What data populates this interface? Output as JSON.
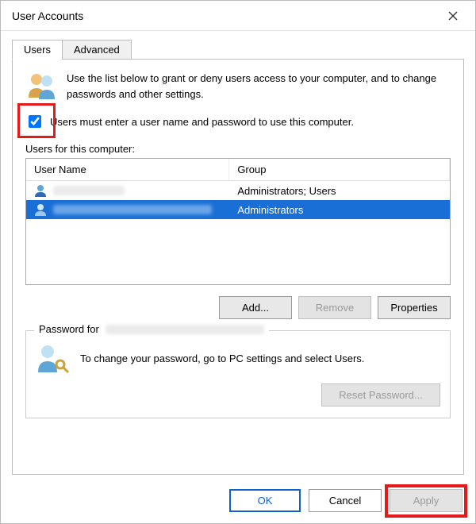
{
  "window": {
    "title": "User Accounts"
  },
  "tabs": {
    "users": "Users",
    "advanced": "Advanced"
  },
  "intro": "Use the list below to grant or deny users access to your computer, and to change passwords and other settings.",
  "checkbox": {
    "label": "Users must enter a user name and password to use this computer.",
    "checked": true
  },
  "users_for_label": "Users for this computer:",
  "columns": {
    "name": "User Name",
    "group": "Group"
  },
  "rows": [
    {
      "group": "Administrators; Users",
      "selected": false
    },
    {
      "group": "Administrators",
      "selected": true
    }
  ],
  "buttons": {
    "add": "Add...",
    "remove": "Remove",
    "properties": "Properties",
    "reset_pw": "Reset Password...",
    "ok": "OK",
    "cancel": "Cancel",
    "apply": "Apply"
  },
  "password_box": {
    "legend": "Password for",
    "text": "To change your password, go to PC settings and select Users."
  }
}
